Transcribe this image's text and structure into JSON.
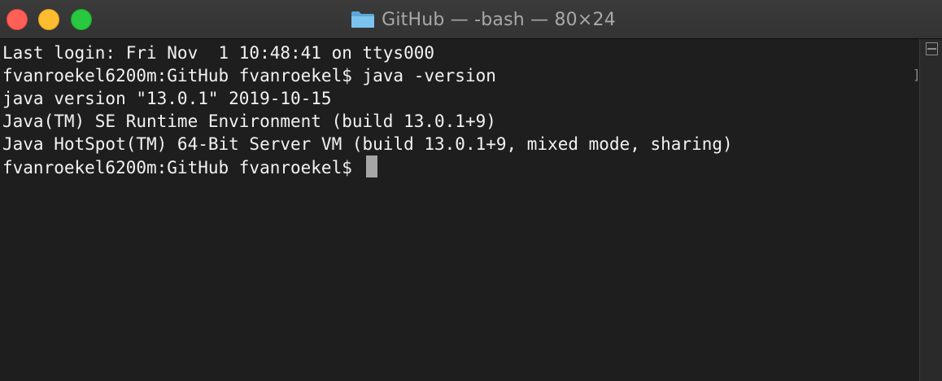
{
  "window": {
    "title": "GitHub — -bash — 80×24"
  },
  "terminal": {
    "lines": [
      "Last login: Fri Nov  1 10:48:41 on ttys000",
      "fvanroekel6200m:GitHub fvanroekel$ java -version",
      "java version \"13.0.1\" 2019-10-15",
      "Java(TM) SE Runtime Environment (build 13.0.1+9)",
      "Java HotSpot(TM) 64-Bit Server VM (build 13.0.1+9, mixed mode, sharing)",
      "fvanroekel6200m:GitHub fvanroekel$ "
    ]
  },
  "icons": {
    "folder": "folder-icon",
    "split": "split-pane-icon"
  },
  "colors": {
    "background": "#1e1e1e",
    "text": "#f2f2f2",
    "cursor": "#a6a6a6",
    "close": "#fe5f57",
    "minimize": "#febc2e",
    "zoom": "#28c840",
    "folder": "#6cb8e6"
  }
}
